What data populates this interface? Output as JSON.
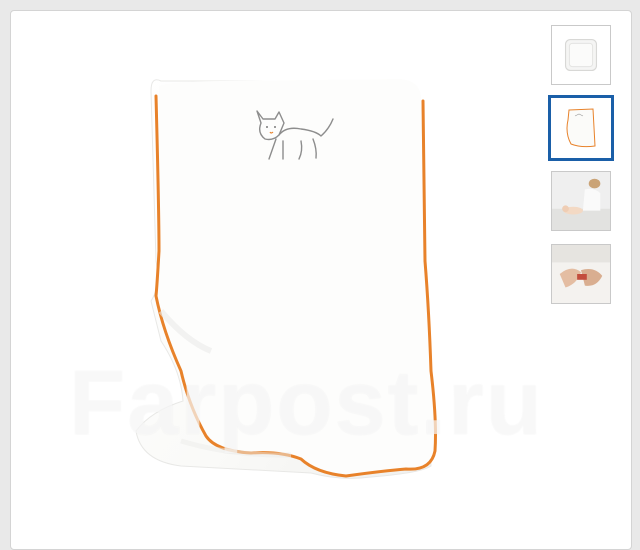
{
  "gallery": {
    "watermark_text": "Farpost.ru",
    "selected_index": 1,
    "thumbnails": [
      {
        "icon": "changing-pad-thumbnail"
      },
      {
        "icon": "pad-cover-thumbnail"
      },
      {
        "icon": "mother-baby-photo-thumbnail"
      },
      {
        "icon": "hands-detail-photo-thumbnail"
      }
    ]
  },
  "colors": {
    "selected_border": "#1a5fa8",
    "trim_orange": "#e8822a",
    "fabric_white": "#fbfbf9"
  }
}
